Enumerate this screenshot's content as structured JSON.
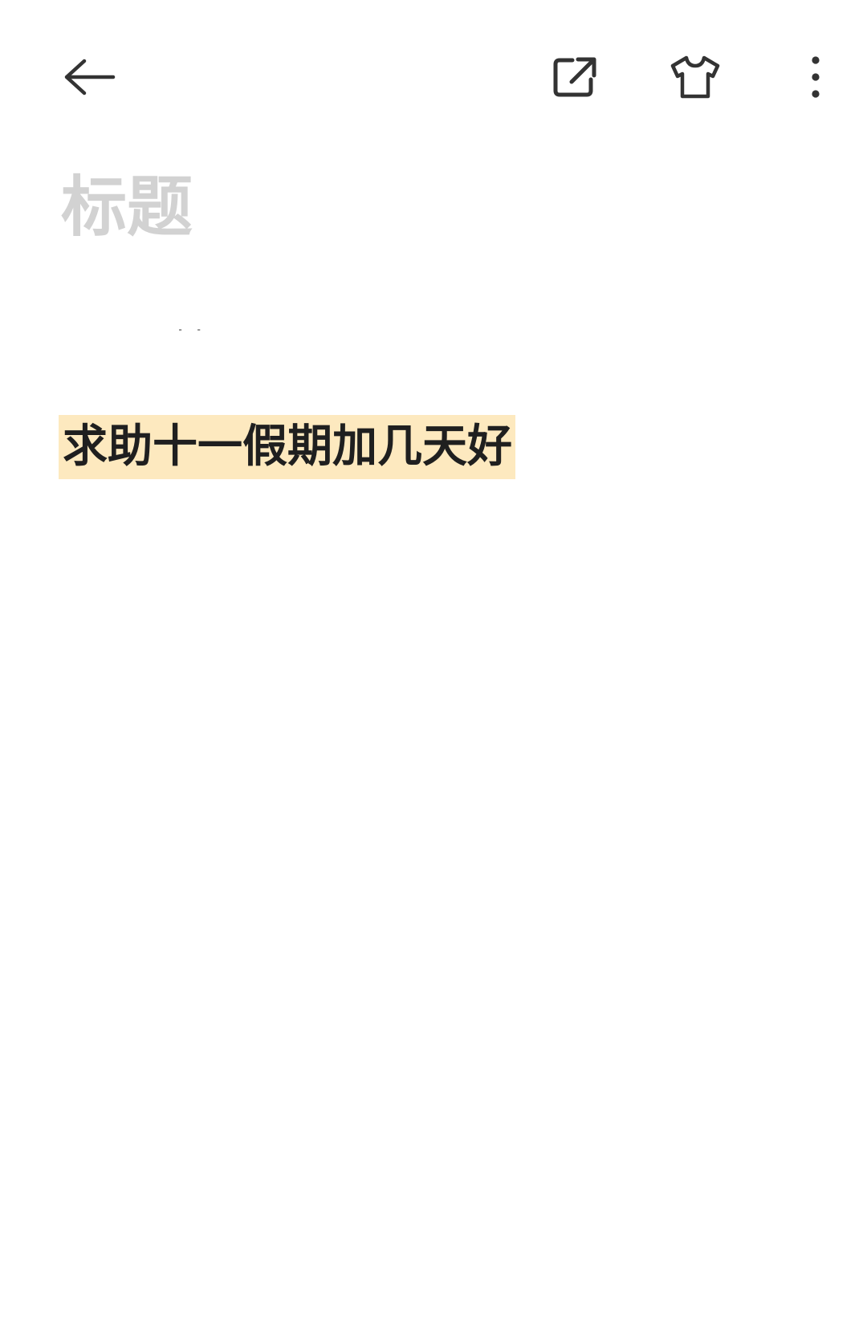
{
  "toolbar": {
    "back_icon": "arrow-left-icon",
    "share_icon": "external-share-icon",
    "theme_icon": "t-shirt-icon",
    "more_icon": "more-vertical-icon"
  },
  "note": {
    "title_placeholder": "标题",
    "title_value": "",
    "cut_fragment": "一日",
    "body_text": "求助十一假期加几天好",
    "highlight_color": "#fde9bf"
  }
}
